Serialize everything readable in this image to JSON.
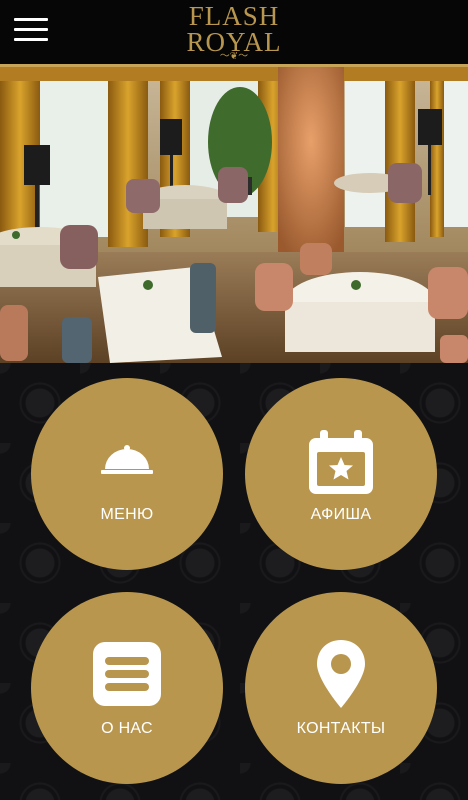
{
  "header": {
    "logo_line1": "FLASH",
    "logo_line2": "ROYAL",
    "menu_icon": "hamburger-icon"
  },
  "hero": {
    "image": "restaurant-hall-photo"
  },
  "tiles": [
    {
      "label": "МЕНЮ",
      "icon": "cloche-icon"
    },
    {
      "label": "АФИША",
      "icon": "calendar-star-icon"
    },
    {
      "label": "О НАС",
      "icon": "list-icon"
    },
    {
      "label": "КОНТАКТЫ",
      "icon": "location-pin-icon"
    }
  ],
  "colors": {
    "gold": "#b8964e",
    "background": "#0d0d10",
    "header": "#060606"
  }
}
